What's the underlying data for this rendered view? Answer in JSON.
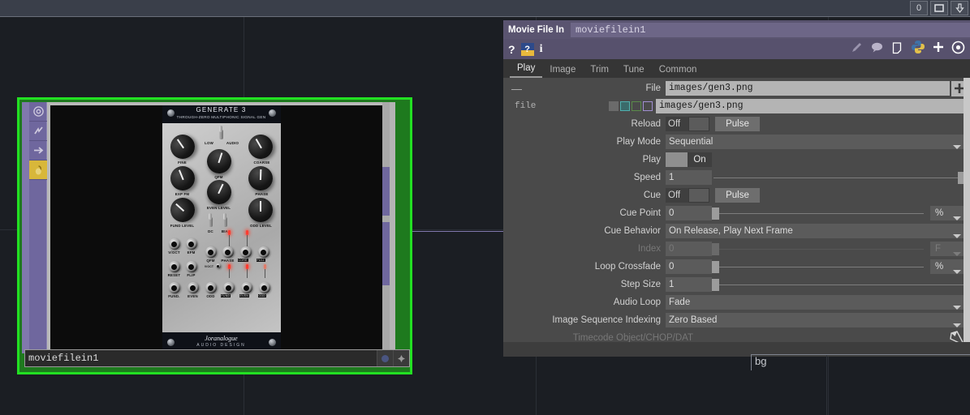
{
  "topbar": {
    "controls": [
      {
        "name": "frame-counter",
        "label": "0"
      },
      {
        "name": "maximize-button",
        "label": ""
      },
      {
        "name": "collapse-button",
        "label": ""
      }
    ]
  },
  "viewer": {
    "side_icons": [
      {
        "name": "viewer-icon-target",
        "label": "target-icon",
        "active": false
      },
      {
        "name": "viewer-icon-bolt",
        "label": "bolt-icon",
        "active": false
      },
      {
        "name": "viewer-icon-arrow",
        "label": "arrow-right-icon",
        "active": false
      },
      {
        "name": "viewer-icon-lock",
        "label": "lock-icon",
        "active": true
      }
    ],
    "node_name": "moviefilein1",
    "image": {
      "title": "GENERATE 3",
      "subtitle": "THROUGH-ZERO MULTIPHONIC SIGNAL GEN",
      "brand": "Joranalogue",
      "brand_sub": "AUDIO DESIGN",
      "knob_labels": [
        "FINE",
        "COARSE",
        "LOW",
        "AUDIO",
        "QFM",
        "PHASE",
        "EXP FM",
        "EVEN LEVEL",
        "FUND LEVEL",
        "ODD LEVEL",
        "DC",
        "BIAS"
      ],
      "jack_labels": [
        "V/OCT",
        "EFM",
        "RESET",
        "FLIP",
        "QFM",
        "PHASE",
        "CORE",
        "FULL",
        "FUND.",
        "EVEN",
        "ODD",
        "FUND",
        "EVEN",
        "ODD"
      ],
      "small_label": "V/OCT"
    }
  },
  "dialog": {
    "op_type": "Movie File In",
    "op_name": "moviefilein1",
    "toolbar_left": [
      {
        "name": "help-icon",
        "label": "?"
      },
      {
        "name": "help-badge-icon",
        "label": "?"
      },
      {
        "name": "info-icon",
        "label": "i"
      }
    ],
    "toolbar_right": [
      {
        "name": "pencil-icon",
        "label": "pencil"
      },
      {
        "name": "comment-icon",
        "label": "comment"
      },
      {
        "name": "note-icon",
        "label": "note"
      },
      {
        "name": "python-icon",
        "label": "python"
      },
      {
        "name": "add-icon",
        "label": "plus"
      },
      {
        "name": "target-icon",
        "label": "target"
      }
    ],
    "tabs": [
      {
        "label": "Play",
        "active": true
      },
      {
        "label": "Image",
        "active": false
      },
      {
        "label": "Trim",
        "active": false
      },
      {
        "label": "Tune",
        "active": false
      },
      {
        "label": "Common",
        "active": false
      }
    ],
    "params": [
      {
        "id": "file",
        "label": "File",
        "type": "file",
        "value": "images/gen3.png",
        "collapse": "—",
        "add": "+"
      },
      {
        "id": "file_expr",
        "label": "file",
        "type": "expr",
        "value": "images/gen3.png",
        "chips": [
          "#6b6b6b",
          "#4fb0ae",
          "#5a8b4a",
          "#a08fd0"
        ]
      },
      {
        "id": "reload",
        "label": "Reload",
        "type": "toggle_pulse",
        "value": "Off",
        "pulse": "Pulse"
      },
      {
        "id": "playmode",
        "label": "Play Mode",
        "type": "menu",
        "value": "Sequential"
      },
      {
        "id": "play",
        "label": "Play",
        "type": "toggle_on",
        "value": "On"
      },
      {
        "id": "speed",
        "label": "Speed",
        "type": "slider",
        "value": "1",
        "pos": 99,
        "unit": null,
        "disabled": false
      },
      {
        "id": "cue",
        "label": "Cue",
        "type": "toggle_pulse",
        "value": "Off",
        "pulse": "Pulse"
      },
      {
        "id": "cuepoint",
        "label": "Cue Point",
        "type": "slider",
        "value": "0",
        "pos": 0,
        "unit": "%",
        "disabled": false
      },
      {
        "id": "cuebehavior",
        "label": "Cue Behavior",
        "type": "menu",
        "value": "On Release, Play Next Frame"
      },
      {
        "id": "index",
        "label": "Index",
        "type": "slider",
        "value": "0",
        "pos": 0,
        "unit": "F",
        "disabled": true
      },
      {
        "id": "loopcrossfade",
        "label": "Loop Crossfade",
        "type": "slider",
        "value": "0",
        "pos": 0,
        "unit": "%",
        "disabled": false
      },
      {
        "id": "stepsize",
        "label": "Step Size",
        "type": "slider",
        "value": "1",
        "pos": 0,
        "unit": null,
        "disabled": false
      },
      {
        "id": "audioloop",
        "label": "Audio Loop",
        "type": "menu",
        "value": "Fade"
      },
      {
        "id": "imgseqindex",
        "label": "Image Sequence Indexing",
        "type": "menu",
        "value": "Zero Based"
      },
      {
        "id": "timecode",
        "label": "Timecode Object/CHOP/DAT",
        "type": "label_only",
        "value": "",
        "disabled": true
      }
    ]
  },
  "network": {
    "bg_label": "bg"
  },
  "colors": {
    "accent_green": "#22e022",
    "title_purple": "#5a5470",
    "panel_gray": "#4a4a4a",
    "field_light": "#b4b4b4"
  }
}
